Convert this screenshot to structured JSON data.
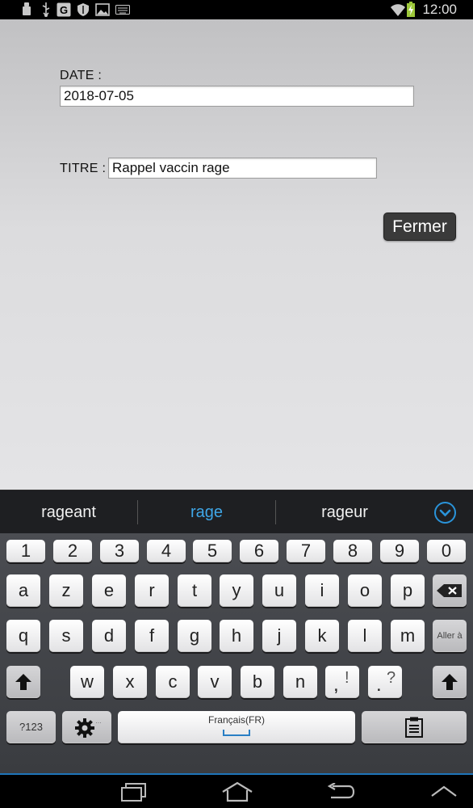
{
  "status_bar": {
    "time": "12:00",
    "icons": [
      "usb-debug-icon",
      "usb-icon",
      "google-icon",
      "shield-icon",
      "image-icon",
      "keyboard-icon",
      "wifi-icon",
      "battery-charging-icon"
    ]
  },
  "form": {
    "date_label": "DATE :",
    "date_value": "2018-07-05",
    "title_label": "TITRE :",
    "title_value": "Rappel vaccin rage",
    "close_button": "Fermer"
  },
  "suggestions": {
    "left": "rageant",
    "middle": "rage",
    "right": "rageur",
    "accent_color": "#3fa7e8"
  },
  "keyboard": {
    "numbers": [
      "1",
      "2",
      "3",
      "4",
      "5",
      "6",
      "7",
      "8",
      "9",
      "0"
    ],
    "row1": [
      "a",
      "z",
      "e",
      "r",
      "t",
      "y",
      "u",
      "i",
      "o",
      "p"
    ],
    "row2": [
      "q",
      "s",
      "d",
      "f",
      "g",
      "h",
      "j",
      "k",
      "l",
      "m"
    ],
    "row3": [
      "w",
      "x",
      "c",
      "v",
      "b",
      "n"
    ],
    "enter_label": "Aller à",
    "comma_main": ",",
    "comma_alt": "!",
    "period_main": ".",
    "period_alt": "?",
    "symbols_label": "?123",
    "space_label": "Français(FR)"
  },
  "nav_bar": {
    "icons": [
      "recent-apps-icon",
      "home-icon",
      "back-icon",
      "hide-keyboard-icon"
    ]
  }
}
